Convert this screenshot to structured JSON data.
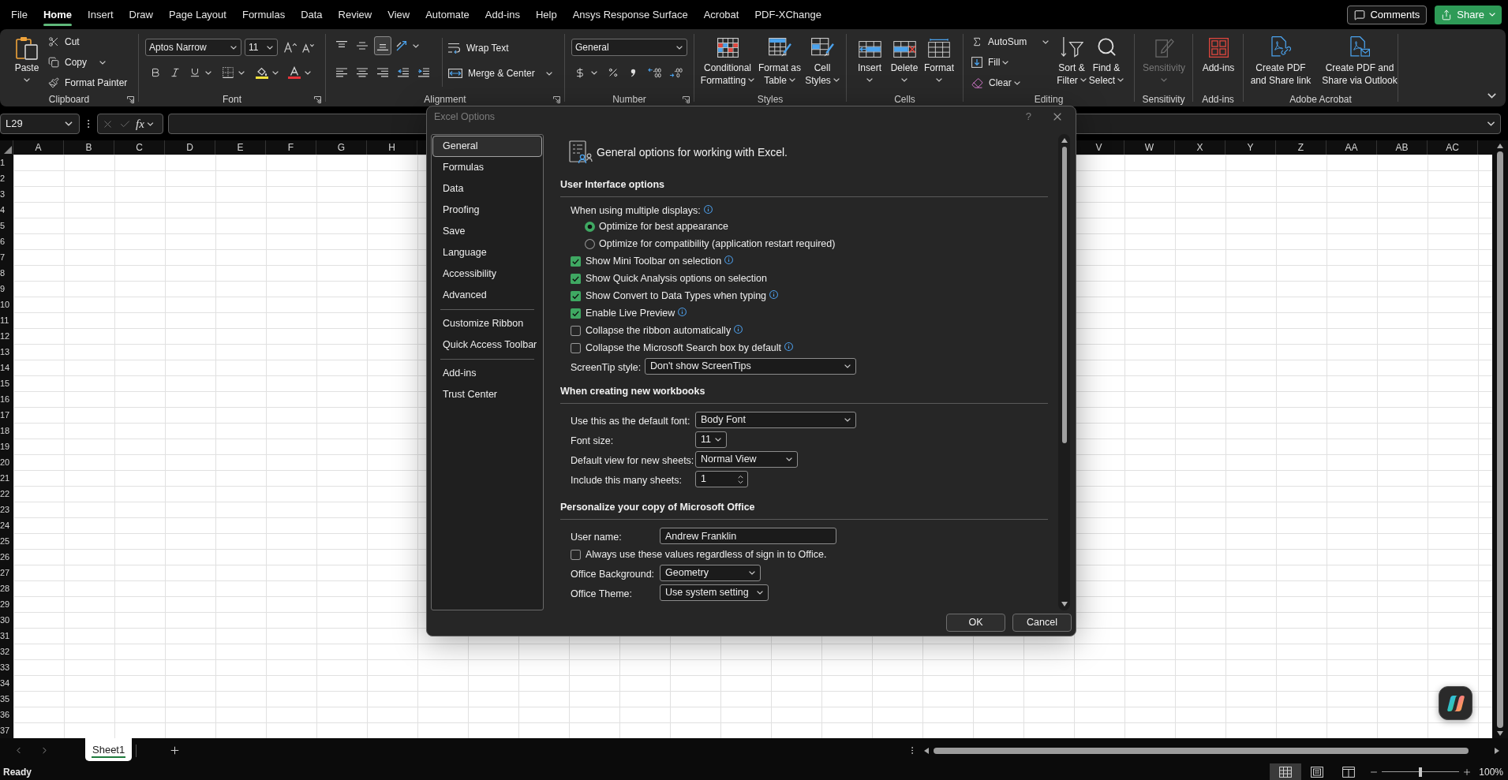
{
  "tabs": [
    {
      "label": "File",
      "selected": false
    },
    {
      "label": "Home",
      "selected": true
    },
    {
      "label": "Insert",
      "selected": false
    },
    {
      "label": "Draw",
      "selected": false
    },
    {
      "label": "Page Layout",
      "selected": false
    },
    {
      "label": "Formulas",
      "selected": false
    },
    {
      "label": "Data",
      "selected": false
    },
    {
      "label": "Review",
      "selected": false
    },
    {
      "label": "View",
      "selected": false
    },
    {
      "label": "Automate",
      "selected": false
    },
    {
      "label": "Add-ins",
      "selected": false
    },
    {
      "label": "Help",
      "selected": false
    },
    {
      "label": "Ansys Response Surface",
      "selected": false
    },
    {
      "label": "Acrobat",
      "selected": false
    },
    {
      "label": "PDF-XChange",
      "selected": false
    }
  ],
  "header_buttons": {
    "comments": "Comments",
    "share": "Share"
  },
  "ribbon": {
    "clipboard": {
      "label": "Clipboard",
      "paste": "Paste",
      "cut": "Cut",
      "copy": "Copy",
      "format_painter": "Format Painter"
    },
    "font": {
      "label": "Font",
      "font_name": "Aptos Narrow",
      "font_size": "11"
    },
    "alignment": {
      "label": "Alignment",
      "vertical_align": [
        {
          "selected": false
        },
        {
          "selected": false
        },
        {
          "selected": true
        }
      ],
      "wrap_text": "Wrap Text",
      "merge_center": "Merge & Center"
    },
    "number": {
      "label": "Number",
      "format": "General"
    },
    "styles": {
      "label": "Styles",
      "buttons": [
        "Conditional Formatting",
        "Format as Table",
        "Cell Styles"
      ]
    },
    "cells": {
      "label": "Cells",
      "buttons": [
        "Insert",
        "Delete",
        "Format"
      ]
    },
    "editing": {
      "label": "Editing",
      "autosum": "AutoSum",
      "fill": "Fill",
      "clear": "Clear",
      "sort_filter": "Sort & Filter",
      "find_select": "Find & Select"
    },
    "sensitivity": {
      "label": "Sensitivity",
      "button": "Sensitivity",
      "disabled": true
    },
    "add_ins": {
      "label": "Add-ins",
      "button": "Add-ins"
    },
    "adobe_acrobat": {
      "label": "Adobe Acrobat",
      "buttons": [
        "Create PDF and Share link",
        "Create PDF and Share via Outlook"
      ]
    }
  },
  "formula_bar": {
    "name_box": "L29",
    "insert_function": "fx"
  },
  "sheet": {
    "columns_left": [
      "A",
      "B",
      "C",
      "D",
      "E",
      "F",
      "G",
      "H"
    ],
    "columns_right": [
      "V",
      "W",
      "X",
      "Y",
      "Z",
      "AA",
      "AB",
      "AC"
    ],
    "rows": [
      "1",
      "2",
      "3",
      "4",
      "5",
      "6",
      "7",
      "8",
      "9",
      "10",
      "11",
      "12",
      "13",
      "14",
      "15",
      "16",
      "17",
      "18",
      "19",
      "20",
      "21",
      "22",
      "23",
      "24",
      "25",
      "26",
      "27",
      "28",
      "29",
      "30",
      "31",
      "32",
      "33",
      "34",
      "35",
      "36",
      "37"
    ]
  },
  "sheet_tabs": [
    {
      "label": "Sheet1",
      "selected": true
    }
  ],
  "status_bar": {
    "status": "Ready",
    "views": [
      {
        "selected": true
      },
      {
        "selected": false
      },
      {
        "selected": false
      }
    ],
    "zoom_slider": {
      "level": 0.5
    },
    "zoom": "100%"
  },
  "dialog": {
    "title": "Excel Options",
    "help": "?",
    "nav_groups": [
      {
        "items": [
          {
            "label": "General",
            "selected": true
          },
          {
            "label": "Formulas",
            "selected": false
          },
          {
            "label": "Data",
            "selected": false
          },
          {
            "label": "Proofing",
            "selected": false
          },
          {
            "label": "Save",
            "selected": false
          },
          {
            "label": "Language",
            "selected": false
          },
          {
            "label": "Accessibility",
            "selected": false
          },
          {
            "label": "Advanced",
            "selected": false
          }
        ]
      },
      {
        "items": [
          {
            "label": "Customize Ribbon",
            "selected": false
          },
          {
            "label": "Quick Access Toolbar",
            "selected": false
          }
        ]
      },
      {
        "items": [
          {
            "label": "Add-ins",
            "selected": false
          },
          {
            "label": "Trust Center",
            "selected": false
          }
        ]
      }
    ],
    "heading": "General options for working with Excel.",
    "sections": [
      {
        "title": "User Interface options",
        "items": [
          {
            "kind": "label",
            "label": "When using multiple displays:",
            "info": true
          },
          {
            "kind": "radio",
            "label": "Optimize for best appearance",
            "selected": true,
            "info": false
          },
          {
            "kind": "radio",
            "label": "Optimize for compatibility (application restart required)",
            "selected": false,
            "info": false
          },
          {
            "kind": "checkbox",
            "label": "Show Mini Toolbar on selection",
            "checked": true,
            "info": true
          },
          {
            "kind": "checkbox",
            "label": "Show Quick Analysis options on selection",
            "checked": true,
            "info": false
          },
          {
            "kind": "checkbox",
            "label": "Show Convert to Data Types when typing",
            "checked": true,
            "info": true
          },
          {
            "kind": "checkbox",
            "label": "Enable Live Preview",
            "checked": true,
            "info": true
          },
          {
            "kind": "checkbox",
            "label": "Collapse the ribbon automatically",
            "checked": false,
            "info": true
          },
          {
            "kind": "checkbox",
            "label": "Collapse the Microsoft Search box by default",
            "checked": false,
            "info": true
          },
          {
            "kind": "select",
            "label": "ScreenTip style:",
            "value": "Don't show ScreenTips"
          }
        ]
      },
      {
        "title": "When creating new workbooks",
        "items": [
          {
            "kind": "select",
            "label": "Use this as the default font:",
            "value": "Body Font"
          },
          {
            "kind": "select",
            "label": "Font size:",
            "value": "11"
          },
          {
            "kind": "select",
            "label": "Default view for new sheets:",
            "value": "Normal View"
          },
          {
            "kind": "spinner",
            "label": "Include this many sheets:",
            "value": "1"
          }
        ]
      },
      {
        "title": "Personalize your copy of Microsoft Office",
        "items": [
          {
            "kind": "text",
            "label": "User name:",
            "value": "Andrew Franklin"
          },
          {
            "kind": "checkbox",
            "label": "Always use these values regardless of sign in to Office.",
            "checked": false,
            "info": false
          },
          {
            "kind": "select",
            "label": "Office Background:",
            "value": "Geometry"
          },
          {
            "kind": "select",
            "label": "Office Theme:",
            "value": "Use system setting"
          }
        ]
      }
    ],
    "buttons": [
      "OK",
      "Cancel"
    ]
  }
}
